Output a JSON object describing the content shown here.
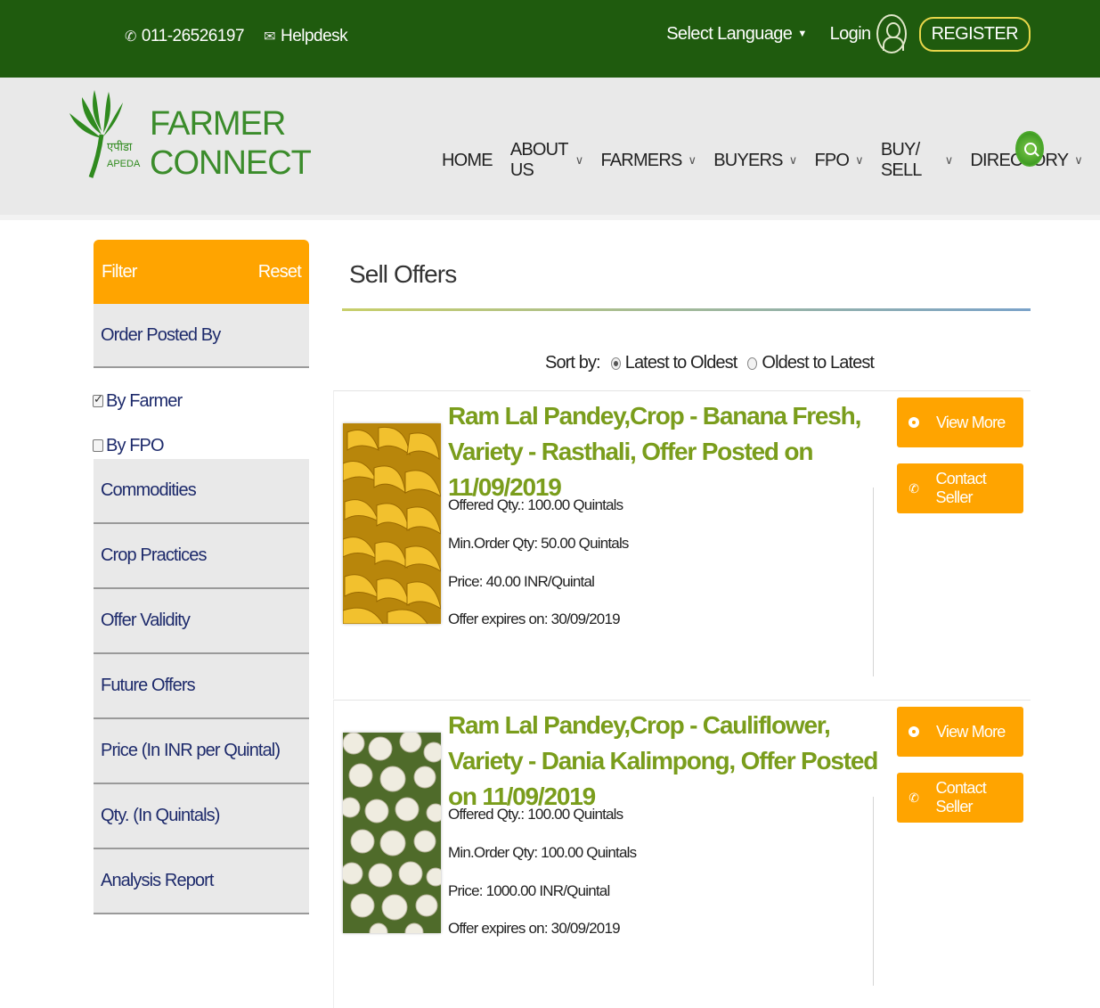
{
  "topbar": {
    "phone": "011-26526197",
    "helpdesk": "Helpdesk",
    "select_language": "Select Language",
    "login": "Login",
    "register": "REGISTER"
  },
  "brand": {
    "line1": "FARMER",
    "line2": "CONNECT",
    "logo_hindi": "एपीडा",
    "logo_text": "APEDA"
  },
  "nav": {
    "items": [
      "HOME",
      "ABOUT US",
      "FARMERS",
      "BUYERS",
      "FPO",
      "BUY/ SELL",
      "DIRECTORY"
    ]
  },
  "sidebar": {
    "filter": "Filter",
    "reset": "Reset",
    "order_posted_by": "Order Posted By",
    "by_farmer": "By Farmer",
    "by_fpo": "By FPO",
    "sections": [
      "Commodities",
      "Crop Practices",
      "Offer Validity",
      "Future Offers",
      "Price (In INR per Quintal)",
      "Qty. (In Quintals)",
      "Analysis Report"
    ]
  },
  "main": {
    "title": "Sell Offers",
    "sort_by": "Sort by:",
    "sort_latest": "Latest to Oldest",
    "sort_oldest": "Oldest to Latest"
  },
  "offers": [
    {
      "heading": "Ram Lal Pandey,Crop - Banana Fresh, Variety - Rasthali, Offer Posted on 11/09/2019",
      "offered_qty": "Offered Qty.: 100.00 Quintals",
      "min_order": "Min.Order Qty: 50.00 Quintals",
      "price": "Price: 40.00 INR/Quintal",
      "expires": "Offer expires on: 30/09/2019",
      "view_more": "View More",
      "contact_seller": "Contact Seller"
    },
    {
      "heading": "Ram Lal Pandey,Crop - Cauliflower, Variety - Dania Kalimpong, Offer Posted on 11/09/2019",
      "offered_qty": "Offered Qty.: 100.00 Quintals",
      "min_order": "Min.Order Qty: 100.00 Quintals",
      "price": "Price: 1000.00 INR/Quintal",
      "expires": "Offer expires on: 30/09/2019",
      "view_more": "View More",
      "contact_seller": "Contact Seller"
    }
  ],
  "colors": {
    "topbar": "#1f5b0e",
    "accent": "#ffa400",
    "heading_green": "#7a9d1c",
    "brand_green": "#3b8c2b",
    "sidebar_text": "#1d2a6b"
  }
}
